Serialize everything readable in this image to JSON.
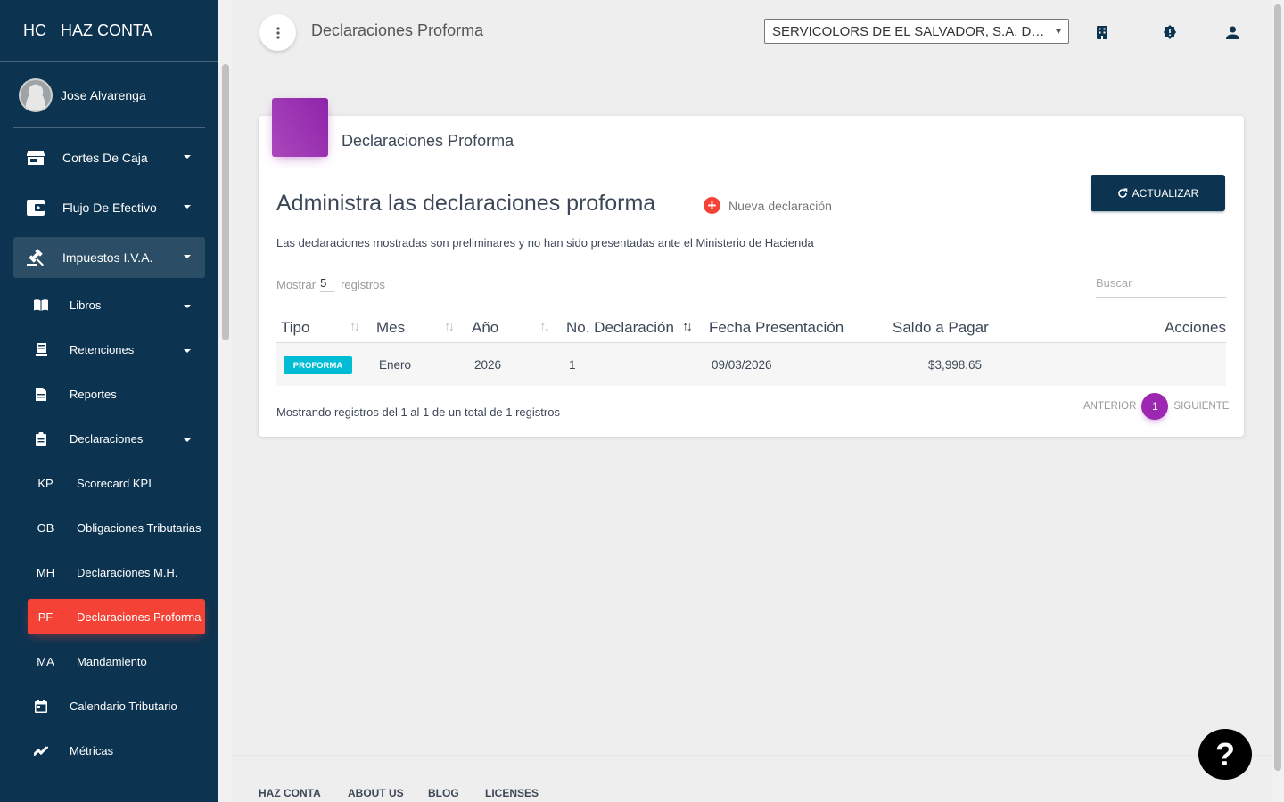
{
  "brand": {
    "mini": "HC",
    "name": "HAZ CONTA"
  },
  "user": {
    "name": "Jose Alvarenga"
  },
  "nav": {
    "cortes": "Cortes De Caja",
    "flujo": "Flujo De Efectivo",
    "impuestos": "Impuestos I.V.A.",
    "libros": "Libros",
    "retenciones": "Retenciones",
    "reportes": "Reportes",
    "declaraciones": "Declaraciones",
    "sub": [
      {
        "mini": "KP",
        "label": "Scorecard KPI"
      },
      {
        "mini": "OB",
        "label": "Obligaciones Tributarias"
      },
      {
        "mini": "MH",
        "label": "Declaraciones M.H."
      },
      {
        "mini": "PF",
        "label": "Declaraciones Proforma"
      },
      {
        "mini": "MA",
        "label": "Mandamiento"
      }
    ],
    "calendario": "Calendario Tributario",
    "metricas": "Métricas"
  },
  "header": {
    "title": "Declaraciones Proforma",
    "company": "SERVICOLORS DE EL SALVADOR, S.A. DE C.V."
  },
  "card": {
    "title": "Declaraciones Proforma",
    "heading": "Administra las declaraciones proforma",
    "new_label": "Nueva declaración",
    "refresh_label": "ACTUALIZAR",
    "note": "Las declaraciones mostradas son preliminares y no han sido presentadas ante el Ministerio de Hacienda",
    "show_prefix": "Mostrar",
    "show_count": "5",
    "show_suffix": "registros",
    "search_placeholder": "Buscar"
  },
  "table": {
    "columns": [
      "Tipo",
      "Mes",
      "Año",
      "No. Declaración",
      "Fecha Presentación",
      "Saldo a Pagar",
      "Acciones"
    ],
    "rows": [
      {
        "tipo": "PROFORMA",
        "mes": "Enero",
        "anio": "2026",
        "numero": "1",
        "fecha": "09/03/2026",
        "saldo": "$3,998.65"
      }
    ]
  },
  "pagination": {
    "summary": "Mostrando registros del 1 al 1 de un total de 1 registros",
    "prev": "ANTERIOR",
    "page": "1",
    "next": "SIGUIENTE"
  },
  "footer": {
    "links": [
      "HAZ CONTA",
      "ABOUT US",
      "BLOG",
      "LICENSES"
    ]
  },
  "help": "?",
  "colors": {
    "sidebar": "#0c3350",
    "active": "#f44336",
    "accent": "#9c27b0",
    "badge": "#00bcd4"
  }
}
